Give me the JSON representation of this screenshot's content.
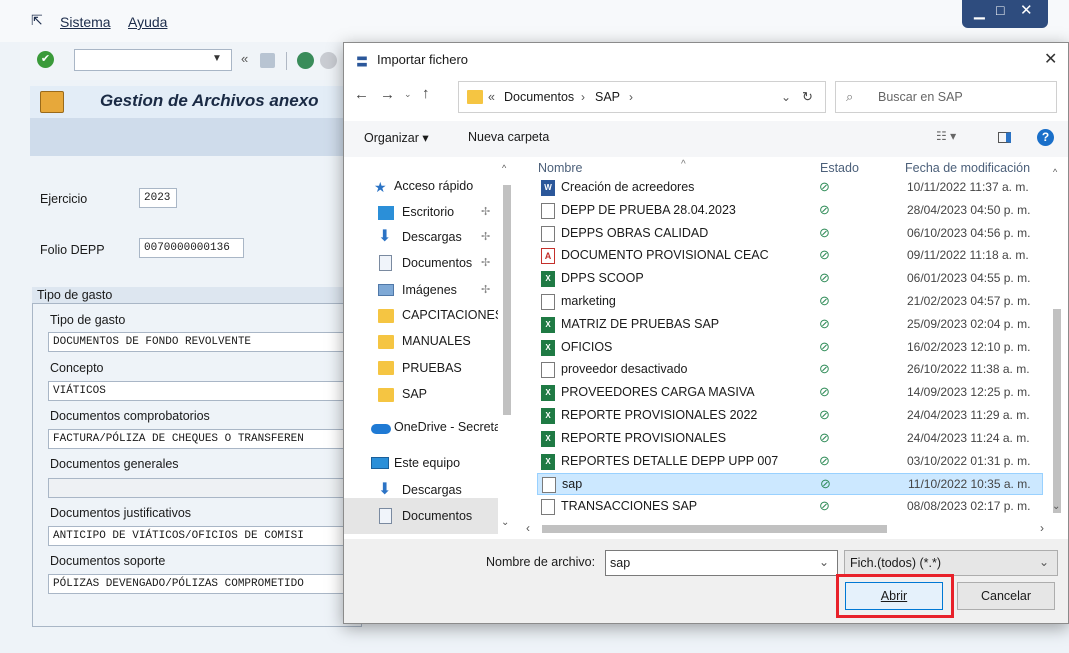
{
  "sap": {
    "menu": [
      "Sistema",
      "Ayuda"
    ],
    "title": "Gestion de Archivos anexo",
    "fields": {
      "ejercicio_label": "Ejercicio",
      "ejercicio_value": "2023",
      "folio_label": "Folio DEPP",
      "folio_value": "0070000000136"
    },
    "group_title": "Tipo de gasto",
    "group_fields": [
      {
        "label": "Tipo de gasto",
        "value": "DOCUMENTOS DE FONDO REVOLVENTE"
      },
      {
        "label": "Concepto",
        "value": "VIÁTICOS"
      },
      {
        "label": "Documentos comprobatorios",
        "value": "FACTURA/PÓLIZA DE CHEQUES O TRANSFEREN"
      },
      {
        "label": "Documentos generales",
        "value": ""
      },
      {
        "label": "Documentos justificativos",
        "value": "ANTICIPO DE VIÁTICOS/OFICIOS DE COMISI"
      },
      {
        "label": "Documentos soporte",
        "value": "PÓLIZAS DEVENGADO/PÓLIZAS COMPROMETIDO"
      }
    ]
  },
  "dialog": {
    "title": "Importar fichero",
    "breadcrumb": {
      "prefix": "«",
      "items": [
        "Documentos",
        "SAP"
      ]
    },
    "search_placeholder": "Buscar en SAP",
    "toolbar": {
      "organize": "Organizar ▾",
      "new_folder": "Nueva carpeta"
    },
    "nav": [
      {
        "label": "Acceso rápido",
        "icon": "star-icon"
      },
      {
        "label": "Escritorio",
        "icon": "desktop-icon"
      },
      {
        "label": "Descargas",
        "icon": "download-icon"
      },
      {
        "label": "Documentos",
        "icon": "document-icon"
      },
      {
        "label": "Imágenes",
        "icon": "image-icon"
      },
      {
        "label": "CAPCITACIONES",
        "icon": "folder-icon"
      },
      {
        "label": "MANUALES",
        "icon": "folder-icon"
      },
      {
        "label": "PRUEBAS",
        "icon": "folder-icon"
      },
      {
        "label": "SAP",
        "icon": "folder-icon"
      },
      {
        "label": "OneDrive - Secreta",
        "icon": "cloud-icon"
      },
      {
        "label": "Este equipo",
        "icon": "computer-icon"
      },
      {
        "label": "Descargas",
        "icon": "download-icon"
      },
      {
        "label": "Documentos",
        "icon": "document-icon"
      }
    ],
    "columns": {
      "name": "Nombre",
      "status": "Estado",
      "date": "Fecha de modificación"
    },
    "files": [
      {
        "name": "Creación de acreedores",
        "type": "word",
        "date": "10/11/2022 11:37 a. m."
      },
      {
        "name": "DEPP DE PRUEBA 28.04.2023",
        "type": "doc",
        "date": "28/04/2023 04:50 p. m."
      },
      {
        "name": "DEPPS OBRAS CALIDAD",
        "type": "doc",
        "date": "06/10/2023 04:56 p. m."
      },
      {
        "name": "DOCUMENTO PROVISIONAL CEAC",
        "type": "pdf",
        "date": "09/11/2022 11:18 a. m."
      },
      {
        "name": "DPPS SCOOP",
        "type": "excel",
        "date": "06/01/2023 04:55 p. m."
      },
      {
        "name": "marketing",
        "type": "doc",
        "date": "21/02/2023 04:57 p. m."
      },
      {
        "name": "MATRIZ DE PRUEBAS SAP",
        "type": "excel",
        "date": "25/09/2023 02:04 p. m."
      },
      {
        "name": "OFICIOS",
        "type": "excel",
        "date": "16/02/2023 12:10 p. m."
      },
      {
        "name": "proveedor desactivado",
        "type": "doc",
        "date": "26/10/2022 11:38 a. m."
      },
      {
        "name": "PROVEEDORES CARGA MASIVA",
        "type": "excel",
        "date": "14/09/2023 12:25 p. m."
      },
      {
        "name": "REPORTE PROVISIONALES 2022",
        "type": "excel",
        "date": "24/04/2023 11:29 a. m."
      },
      {
        "name": "REPORTE PROVISIONALES",
        "type": "excel",
        "date": "24/04/2023 11:24 a. m."
      },
      {
        "name": "REPORTES DETALLE DEPP UPP 007",
        "type": "excel",
        "date": "03/10/2022 01:31 p. m."
      },
      {
        "name": "sap",
        "type": "doc",
        "date": "11/10/2022 10:35 a. m.",
        "selected": true
      },
      {
        "name": "TRANSACCIONES SAP",
        "type": "doc",
        "date": "08/08/2023 02:17 p. m."
      }
    ],
    "status_symbol": "⊘",
    "filename_label": "Nombre de archivo:",
    "filename_value": "sap",
    "filter_value": "Fich.(todos) (*.*)",
    "open_label": "Abrir",
    "cancel_label": "Cancelar",
    "highlight_color": "#e8212a",
    "selection_color": "#cce8ff"
  }
}
